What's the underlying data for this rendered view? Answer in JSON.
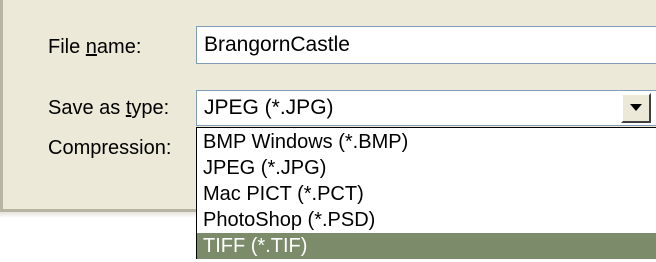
{
  "form": {
    "file_name_label_pre": "File ",
    "file_name_label_u": "n",
    "file_name_label_post": "ame:",
    "file_name_value": "BrangornCastle",
    "save_as_type_label_pre": "Save as ",
    "save_as_type_label_u": "t",
    "save_as_type_label_post": "ype:",
    "save_as_type_value": "JPEG (*.JPG)",
    "compression_label": "Compression:"
  },
  "dropdown": {
    "options": [
      "BMP Windows (*.BMP)",
      "JPEG (*.JPG)",
      "Mac PICT (*.PCT)",
      "PhotoShop (*.PSD)",
      "TIFF (*.TIF)"
    ],
    "highlighted_option": "TIFF (*.TIF)"
  },
  "colors": {
    "dialog_background": "#ece9d8",
    "highlight": "#7c8b6a",
    "field_border": "#7f9db9"
  },
  "icons": {
    "select_arrow": "chevron-down-icon"
  }
}
